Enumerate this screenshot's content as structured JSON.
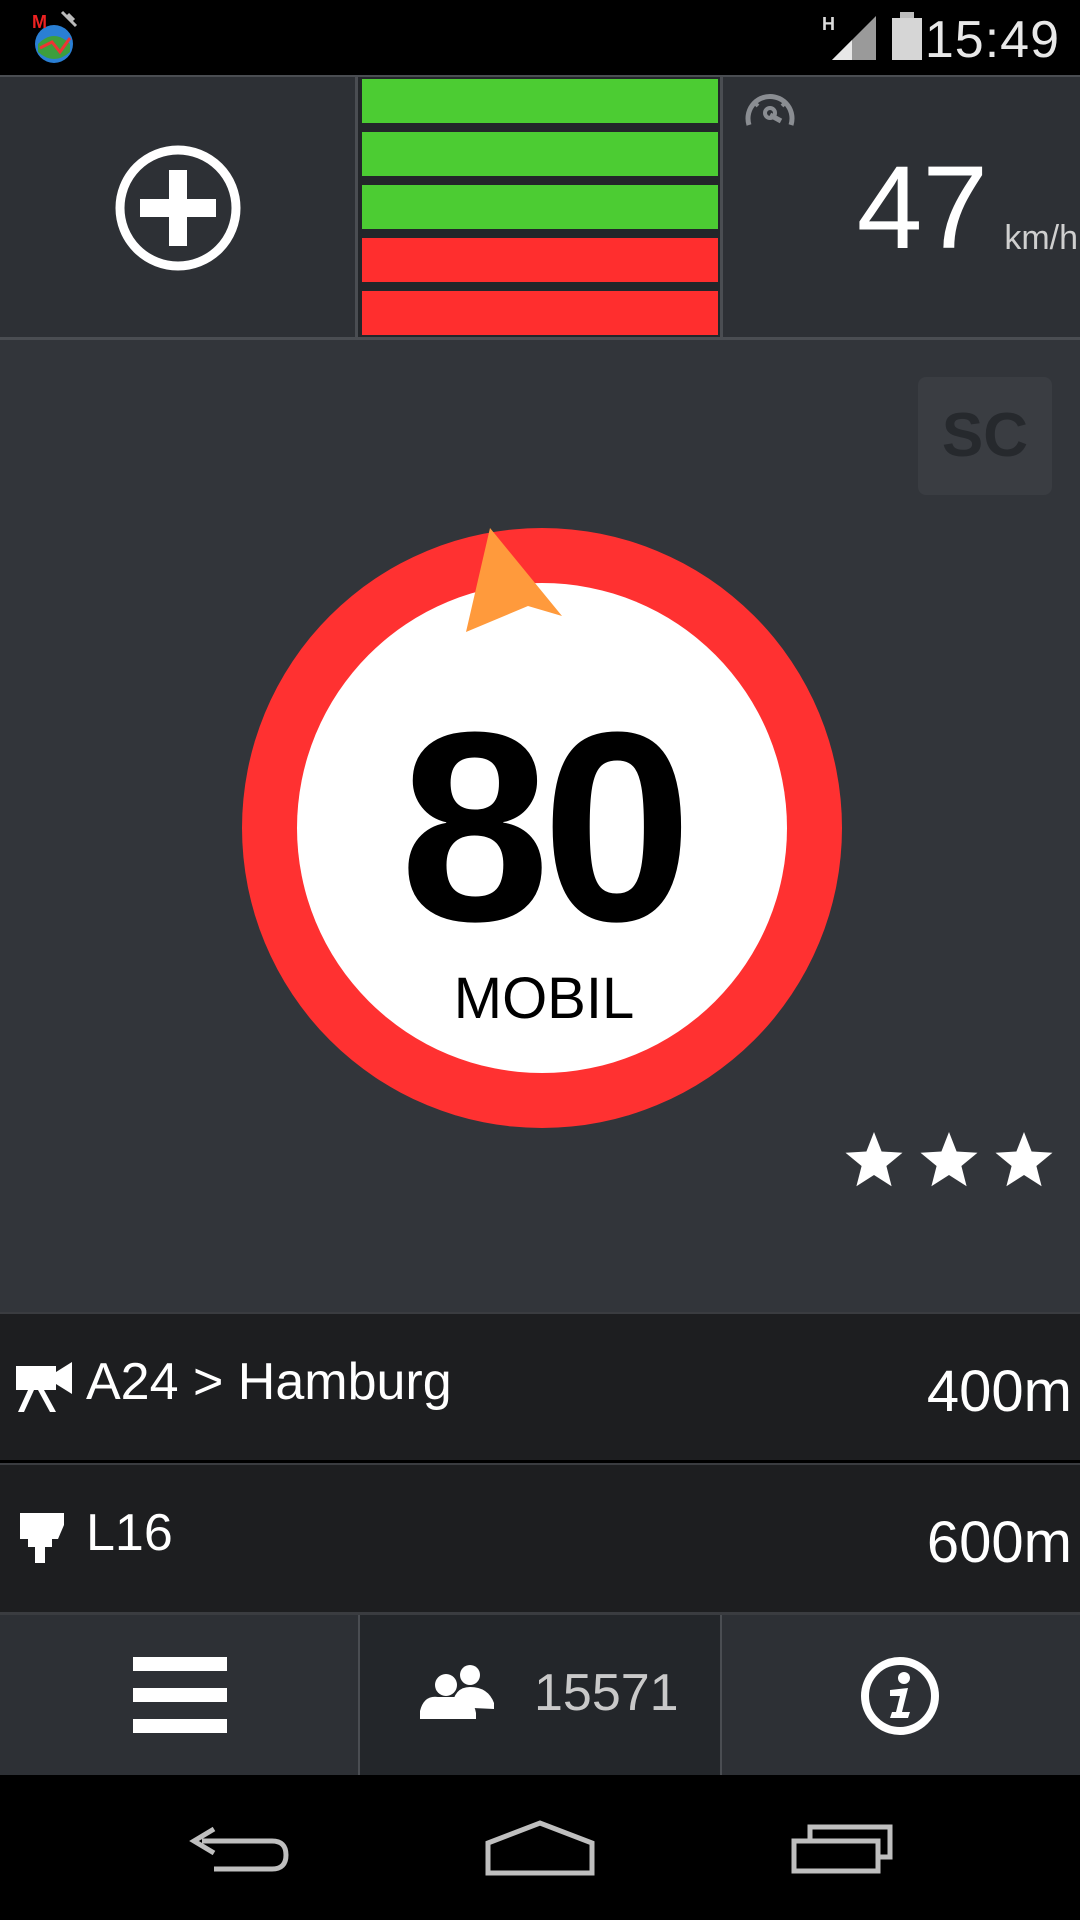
{
  "status_bar": {
    "time": "15:49",
    "network_type": "H",
    "icons": [
      "app-notification-icon",
      "network-h-icon",
      "signal-strength-icon",
      "battery-icon"
    ]
  },
  "top_panel": {
    "add_button_icon": "plus-circle-icon",
    "signal_bars": [
      {
        "color": "#4ccc33"
      },
      {
        "color": "#4ccc33"
      },
      {
        "color": "#4ccc33"
      },
      {
        "color": "#ff2e2e"
      },
      {
        "color": "#ff2e2e"
      }
    ],
    "speedometer_icon": "speedometer-icon",
    "current_speed": "47",
    "speed_unit": "km/h"
  },
  "main_panel": {
    "badge": "SC",
    "speed_limit": "80",
    "camera_type": "MOBIL",
    "direction_icon": "direction-arrow-icon",
    "rating_stars": 3,
    "colors": {
      "ring": "#ff3131",
      "arrow": "#ff9a3c",
      "sign_face": "#ffffff"
    }
  },
  "alerts": [
    {
      "icon": "video-camera-icon",
      "label": "A24 > Hamburg",
      "distance": "400m"
    },
    {
      "icon": "fixed-camera-icon",
      "label": "L16",
      "distance": "600m"
    }
  ],
  "toolbar": {
    "menu_icon": "hamburger-menu-icon",
    "users_icon": "users-icon",
    "user_count": "15571",
    "info_icon": "info-icon"
  },
  "navigation": {
    "icons": [
      "back-icon",
      "home-icon",
      "recent-apps-icon"
    ]
  }
}
